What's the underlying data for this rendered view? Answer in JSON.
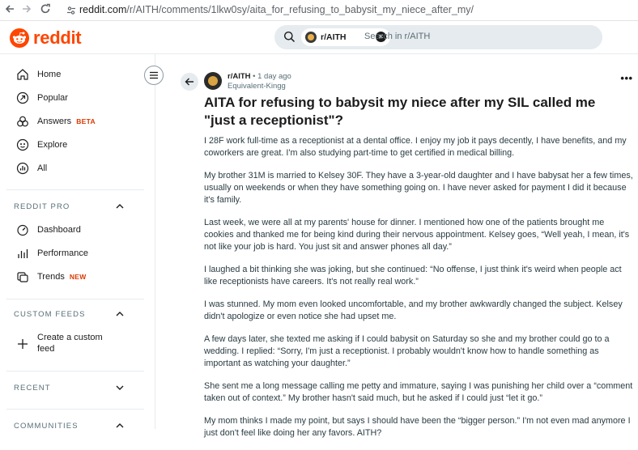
{
  "browser": {
    "url_domain": "reddit.com",
    "url_path": "/r/AITH/comments/1lkw0sy/aita_for_refusing_to_babysit_my_niece_after_my/"
  },
  "header": {
    "logo_text": "reddit",
    "search_chip": "r/AITH",
    "search_placeholder": "Search in r/AITH"
  },
  "sidebar": {
    "items": [
      {
        "label": "Home",
        "icon": "home-icon"
      },
      {
        "label": "Popular",
        "icon": "popular-icon"
      },
      {
        "label": "Answers",
        "icon": "answers-icon",
        "badge": "BETA"
      },
      {
        "label": "Explore",
        "icon": "explore-icon"
      },
      {
        "label": "All",
        "icon": "all-icon"
      }
    ],
    "reddit_pro": {
      "heading": "REDDIT PRO",
      "items": [
        {
          "label": "Dashboard",
          "icon": "dashboard-icon"
        },
        {
          "label": "Performance",
          "icon": "performance-icon"
        },
        {
          "label": "Trends",
          "icon": "trends-icon",
          "badge": "NEW"
        }
      ]
    },
    "custom_feeds": {
      "heading": "CUSTOM FEEDS",
      "create_line1": "Create a custom",
      "create_line2": "feed"
    },
    "recent_heading": "RECENT",
    "communities_heading": "COMMUNITIES"
  },
  "post": {
    "subreddit": "r/AITH",
    "time": "1 day ago",
    "author": "Equivalent-Kingg",
    "title": "AITA for refusing to babysit my niece after my SIL called me \"just a receptionist\"?",
    "paragraphs": [
      "I 28F work full-time as a receptionist at a dental office. I enjoy my job it pays decently, I have benefits, and my coworkers are great. I'm also studying part-time to get certified in medical billing.",
      "My brother 31M is married to Kelsey 30F. They have a 3-year-old daughter and I have babysat her a few times, usually on weekends or when they have something going on. I have never asked for payment I did it because it's family.",
      "Last week, we were all at my parents' house for dinner. I mentioned how one of the patients brought me cookies and thanked me for being kind during their nervous appointment. Kelsey goes, “Well yeah, I mean, it's not like your job is hard. You just sit and answer phones all day.”",
      "I laughed a bit thinking she was joking, but she continued: “No offense, I just think it's weird when people act like receptionists have careers. It's not really real work.”",
      "I was stunned. My mom even looked uncomfortable, and my brother awkwardly changed the subject. Kelsey didn't apologize or even notice she had upset me.",
      "A few days later, she texted me asking if I could babysit on Saturday so she and my brother could go to a wedding. I replied: “Sorry, I'm just a receptionist. I probably wouldn't know how to handle something as important as watching your daughter.”",
      "She sent me a long message calling me petty and immature, saying I was punishing her child over a “comment taken out of context.” My brother hasn't said much, but he asked if I could just “let it go.”",
      "My mom thinks I made my point, but says I should have been the “bigger person.” I'm not even mad anymore I just don't feel like doing her any favors. AITH?"
    ]
  },
  "colors": {
    "brand": "#ff4500",
    "badge": "#d93900",
    "search_bg": "#e5ebee",
    "body_text": "#2a3c42"
  }
}
